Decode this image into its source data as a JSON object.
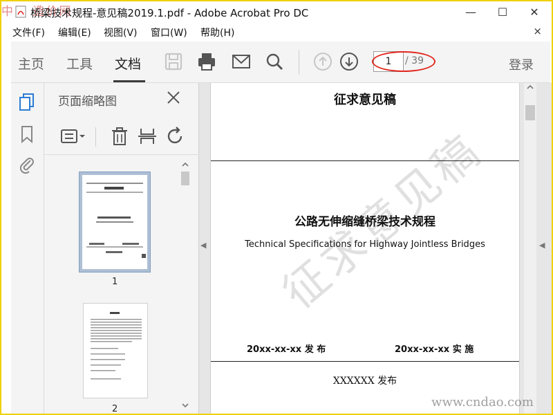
{
  "window": {
    "title": "桥梁技术规程-意见稿2019.1.pdf - Adobe Acrobat Pro DC",
    "site_watermark": "中国 造价网",
    "controls": {
      "minimize": "—",
      "maximize": "☐",
      "close": "✕"
    }
  },
  "menu": {
    "items": [
      "文件(F)",
      "编辑(E)",
      "视图(V)",
      "窗口(W)",
      "帮助(H)"
    ],
    "close": "×"
  },
  "toolbar": {
    "tabs": [
      "主页",
      "工具",
      "文档"
    ],
    "active_tab": "文档",
    "page_current": "1",
    "page_total": "/ 39",
    "login": "登录",
    "icons": [
      "save-icon",
      "print-icon",
      "email-icon",
      "search-icon",
      "prev-page-icon",
      "next-page-icon"
    ]
  },
  "rail": {
    "icons": [
      "page-thumbnails-icon",
      "bookmark-icon",
      "attachment-icon"
    ]
  },
  "thumbnails": {
    "header": "页面缩略图",
    "pages": [
      "1",
      "2"
    ],
    "tools": [
      "options-icon",
      "delete-icon",
      "insert-icon",
      "rotate-icon"
    ]
  },
  "document": {
    "draft_title": "征求意见稿",
    "title_cn": "公路无伸缩缝桥梁技术规程",
    "title_en": "Technical Specifications for Highway Jointless Bridges",
    "publish": "20xx-xx-xx  发  布",
    "implement": "20xx-xx-xx  实  施",
    "issuer": "XXXXXX  发布",
    "watermark": "征求意见稿"
  },
  "bottom_watermark": "www.cndao.com",
  "colors": {
    "highlight_ellipse": "#e0281e",
    "border": "#f0d000",
    "thumb_selected": "#aebfd4"
  }
}
